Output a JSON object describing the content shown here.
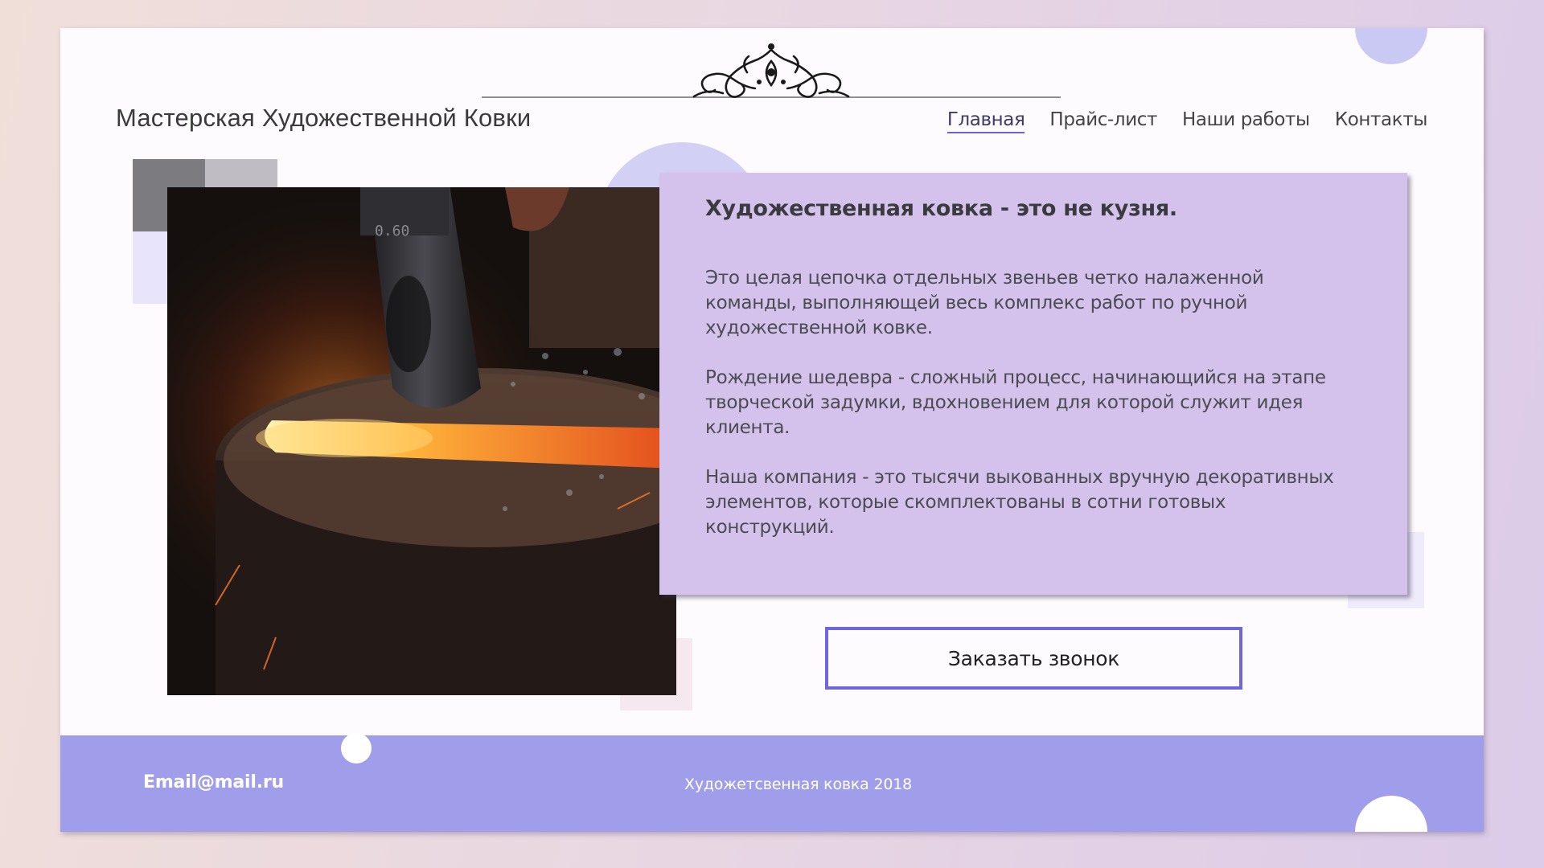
{
  "header": {
    "site_title": "Мастерская Художественной Ковки",
    "nav": [
      {
        "label": "Главная",
        "active": true
      },
      {
        "label": "Прайс-лист",
        "active": false
      },
      {
        "label": "Наши работы",
        "active": false
      },
      {
        "label": "Контакты",
        "active": false
      }
    ]
  },
  "main": {
    "heading": "Художественная ковка - это не кузня.",
    "paragraphs": [
      "Это целая цепочка отдельных звеньев четко налаженной команды, выполняющей весь комплекс работ по ручной художественной ковке.",
      "Рождение шедевра - сложный процесс, начинающийся на этапе творческой задумки, вдохновением для которой служит идея клиента.",
      "Наша компания - это тысячи выкованных вручную декоративных элементов, которые скомплектованы в сотни готовых конструкций."
    ],
    "cta_label": "Заказать звонок",
    "photo_icon": "forging-hammer-photo"
  },
  "footer": {
    "email": "Email@mail.ru",
    "copyright": "Художетсвенная ковка 2018"
  },
  "colors": {
    "accent": "#6d67dd",
    "footer_bg": "#a09eea",
    "text_panel_bg": "#d4c2ec",
    "card_bg": "#fefbfe"
  },
  "icons": {
    "ornament": "ornament-icon"
  }
}
